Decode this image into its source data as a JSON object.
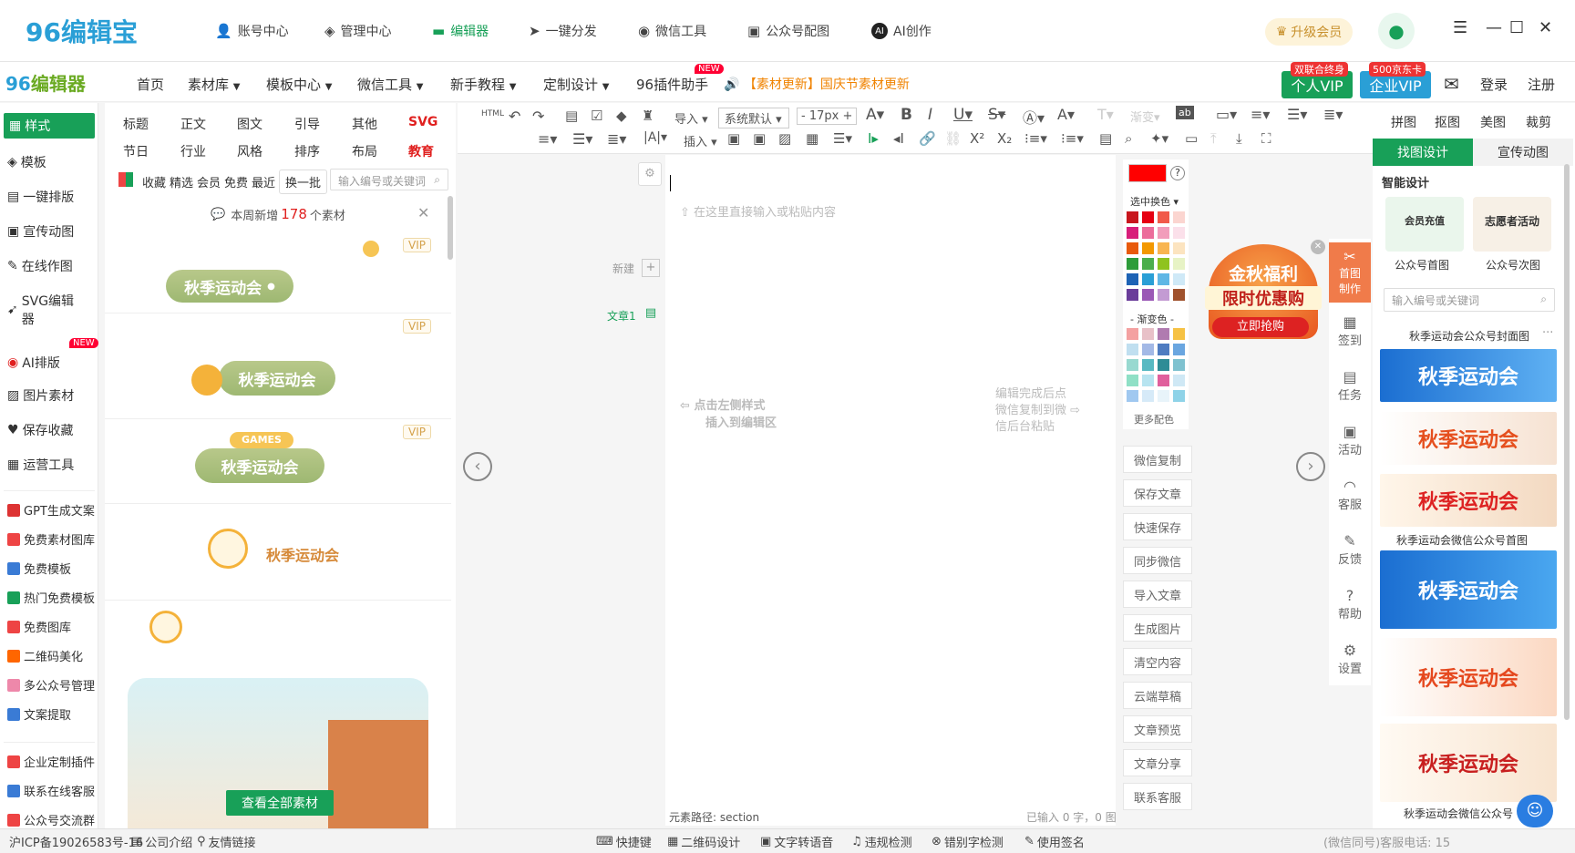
{
  "app": {
    "logo": "96编辑宝",
    "logo2_a": "96",
    "logo2_b": "编辑器"
  },
  "topnav": [
    {
      "label": "账号中心",
      "icon": "user-icon"
    },
    {
      "label": "管理中心",
      "icon": "layers-icon"
    },
    {
      "label": "编辑器",
      "icon": "monitor-icon"
    },
    {
      "label": "一键分发",
      "icon": "send-icon"
    },
    {
      "label": "微信工具",
      "icon": "wechat-icon"
    },
    {
      "label": "公众号配图",
      "icon": "image-icon"
    },
    {
      "label": "AI创作",
      "icon": "ai-icon"
    }
  ],
  "upgrade_label": "升级会员",
  "menu": {
    "items": [
      "首页",
      "素材库",
      "模板中心",
      "微信工具",
      "新手教程",
      "定制设计",
      "96插件助手"
    ],
    "new_badge": "NEW",
    "marquee": "【素材更新】国庆节素材更新",
    "login": "登录",
    "register": "注册"
  },
  "vip": {
    "personal": "个人VIP",
    "personal_tag": "双联合终身",
    "enterprise": "企业VIP",
    "enterprise_tag": "500京东卡"
  },
  "leftnav": {
    "main": [
      "样式",
      "模板",
      "一键排版",
      "宣传动图",
      "在线作图",
      "SVG编辑器",
      "AI排版",
      "图片素材",
      "保存收藏",
      "运营工具"
    ],
    "ai_badge": "NEW",
    "tools": [
      "GPT生成文案",
      "免费素材图库",
      "免费模板",
      "热门免费模板",
      "免费图库",
      "二维码美化",
      "多公众号管理",
      "文案提取"
    ],
    "bottom": [
      "企业定制插件",
      "联系在线客服",
      "公众号交流群"
    ]
  },
  "stylepanel": {
    "cats_row1": [
      "标题",
      "正文",
      "图文",
      "引导",
      "其他",
      "SVG"
    ],
    "cats_row2": [
      "节日",
      "行业",
      "风格",
      "排序",
      "布局",
      "教育"
    ],
    "filters": [
      "收藏",
      "精选",
      "会员",
      "免费",
      "最近"
    ],
    "swap_label": "换一批",
    "search_placeholder": "输入编号或关键词",
    "notice_prefix": "本周新增",
    "notice_count": "178",
    "notice_suffix": "个素材",
    "card_text": "秋季运动会",
    "vip_label": "VIP",
    "games_label": "GAMES",
    "view_all": "查看全部素材"
  },
  "toolbar": {
    "import": "导入",
    "font": "系统默认",
    "size": "17px",
    "insert": "插入"
  },
  "editor": {
    "new_label": "新建",
    "article_label": "文章1",
    "placeholder": "在这里直接输入或粘贴内容",
    "hint_left_a": "点击左侧样式",
    "hint_left_b": "插入到编辑区",
    "hint_right_a": "编辑完成后点",
    "hint_right_b": "微信复制到微",
    "hint_right_c": "信后台粘贴",
    "path_label": "元素路径:",
    "path_value": "section",
    "count_text": "已输入 0 字，0 图"
  },
  "colorpanel": {
    "select_label": "选中换色",
    "gradient_label": "渐变色",
    "more_label": "更多配色"
  },
  "actions": [
    "微信复制",
    "保存文章",
    "快速保存",
    "同步微信",
    "导入文章",
    "生成图片",
    "清空内容",
    "云端草稿",
    "文章预览",
    "文章分享",
    "联系客服"
  ],
  "promo": {
    "line1": "金秋福利",
    "line2": "限时优惠购",
    "cta": "立即抢购"
  },
  "rightbar": [
    {
      "label": "首图制作"
    },
    {
      "label": "签到"
    },
    {
      "label": "任务"
    },
    {
      "label": "活动"
    },
    {
      "label": "客服"
    },
    {
      "label": "反馈"
    },
    {
      "label": "帮助"
    },
    {
      "label": "设置"
    }
  ],
  "rightpanel": {
    "tabs": [
      "拼图",
      "抠图",
      "美图",
      "裁剪"
    ],
    "subtabs": [
      "找图设计",
      "宣传动图"
    ],
    "section": "智能设计",
    "items": [
      "公众号首图",
      "公众号次图"
    ],
    "item_texts": [
      "会员充值",
      "志愿者活动"
    ],
    "search_placeholder": "输入编号或关键词",
    "group1": "秋季运动会公众号封面图",
    "group2": "秋季运动会微信公众号首图",
    "group3": "秋季运动会微信公众号",
    "thumbs": [
      "秋季运动会",
      "秋季运动会",
      "秋季运动会",
      "秋季运动会",
      "秋季运动会",
      "秋季运动会"
    ]
  },
  "status": {
    "icp": "沪ICP备19026583号-16",
    "company": "公司介绍",
    "links": "友情链接",
    "tools": [
      "快捷键",
      "二维码设计",
      "文字转语音",
      "违规检测",
      "错别字检测",
      "使用签名"
    ],
    "service": "(微信同号)客服电话: 15"
  },
  "colors": {
    "green": "#18a058",
    "red": "#e0201f",
    "blue": "#2a9fd6"
  }
}
